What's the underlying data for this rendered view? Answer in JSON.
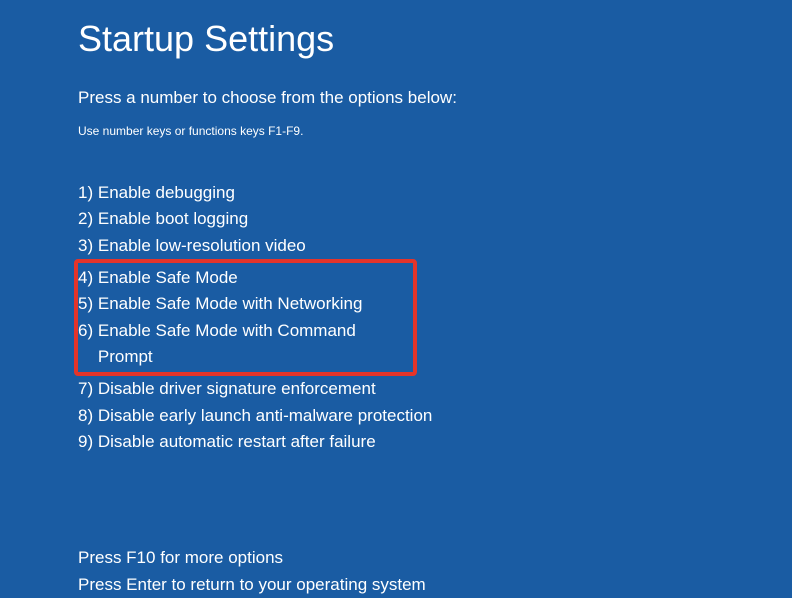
{
  "title": "Startup Settings",
  "subtitle": "Press a number to choose from the options below:",
  "hint": "Use number keys or functions keys F1-F9.",
  "options": [
    {
      "num": "1)",
      "label": "Enable debugging"
    },
    {
      "num": "2)",
      "label": "Enable boot logging"
    },
    {
      "num": "3)",
      "label": "Enable low-resolution video"
    },
    {
      "num": "4)",
      "label": "Enable Safe Mode"
    },
    {
      "num": "5)",
      "label": "Enable Safe Mode with Networking"
    },
    {
      "num": "6)",
      "label": "Enable Safe Mode with Command Prompt"
    },
    {
      "num": "7)",
      "label": "Disable driver signature enforcement"
    },
    {
      "num": "8)",
      "label": "Disable early launch anti-malware protection"
    },
    {
      "num": "9)",
      "label": "Disable automatic restart after failure"
    }
  ],
  "footer": {
    "more": "Press F10 for more options",
    "back": "Press Enter to return to your operating system"
  }
}
